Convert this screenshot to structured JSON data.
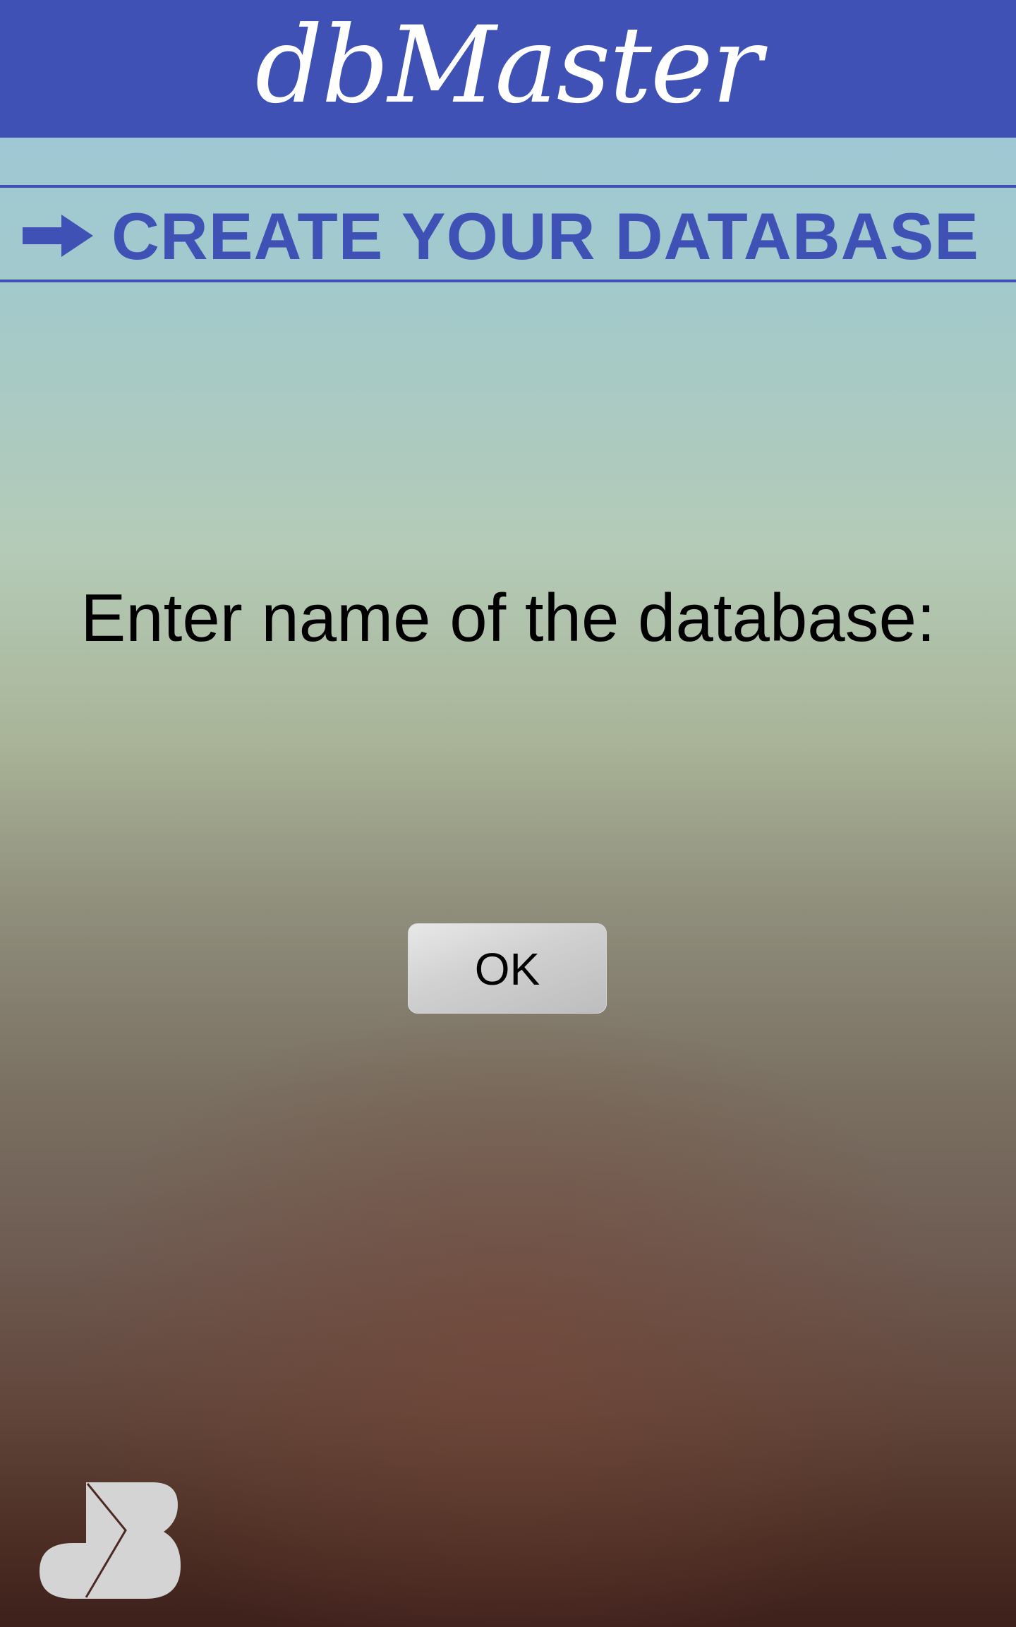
{
  "header": {
    "title": "dbMaster"
  },
  "section": {
    "icon": "arrow-right-icon",
    "title": "CREATE YOUR DATABASE"
  },
  "form": {
    "prompt": "Enter name of the database:",
    "ok_label": "OK"
  },
  "logo": {
    "icon": "db-logo-icon"
  },
  "colors": {
    "brand": "#3f51b5",
    "header_text": "#ffffff",
    "button_bg": "#cfcfcf",
    "logo": "#d4d4d4"
  }
}
